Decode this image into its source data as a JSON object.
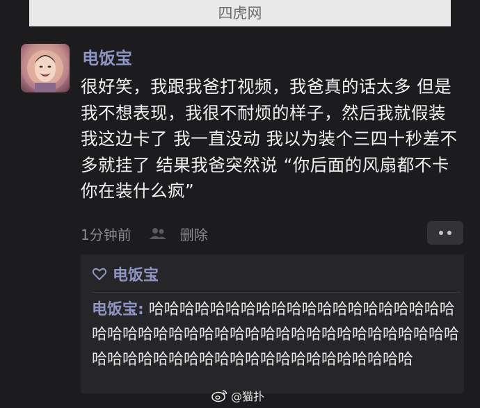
{
  "banner": {
    "text": "四虎网"
  },
  "post": {
    "username": "电饭宝",
    "text": "很好笑，我跟我爸打视频，我爸真的话太多 但是我不想表现，我很不耐烦的样子，然后我就假装我这边卡了 我一直没动 我以为装个三四十秒差不多就挂了 结果我爸突然说 “你后面的风扇都不卡你在装什么疯”",
    "time": "1分钟前",
    "delete_label": "删除"
  },
  "comment_box": {
    "like_user": "电饭宝",
    "reply_name": "电饭宝:",
    "reply_text": " 哈哈哈哈哈哈哈哈哈哈哈哈哈哈哈哈哈哈哈哈哈哈哈哈哈哈哈哈哈哈哈哈哈哈哈哈哈哈哈哈哈哈哈哈哈哈哈哈哈哈哈哈哈哈哈哈哈哈哈哈哈哈哈哈哈"
  },
  "watermark": {
    "text": "@猫扑"
  },
  "icons": {
    "people": "people-icon",
    "more": "more-dots-icon",
    "heart": "heart-outline-icon",
    "weibo": "weibo-logo-icon"
  },
  "colors": {
    "background": "#1c1c1e",
    "username": "#8e95c2",
    "text": "#f1f1f1",
    "meta": "#8b8b8f",
    "comment_bg": "#262629"
  }
}
